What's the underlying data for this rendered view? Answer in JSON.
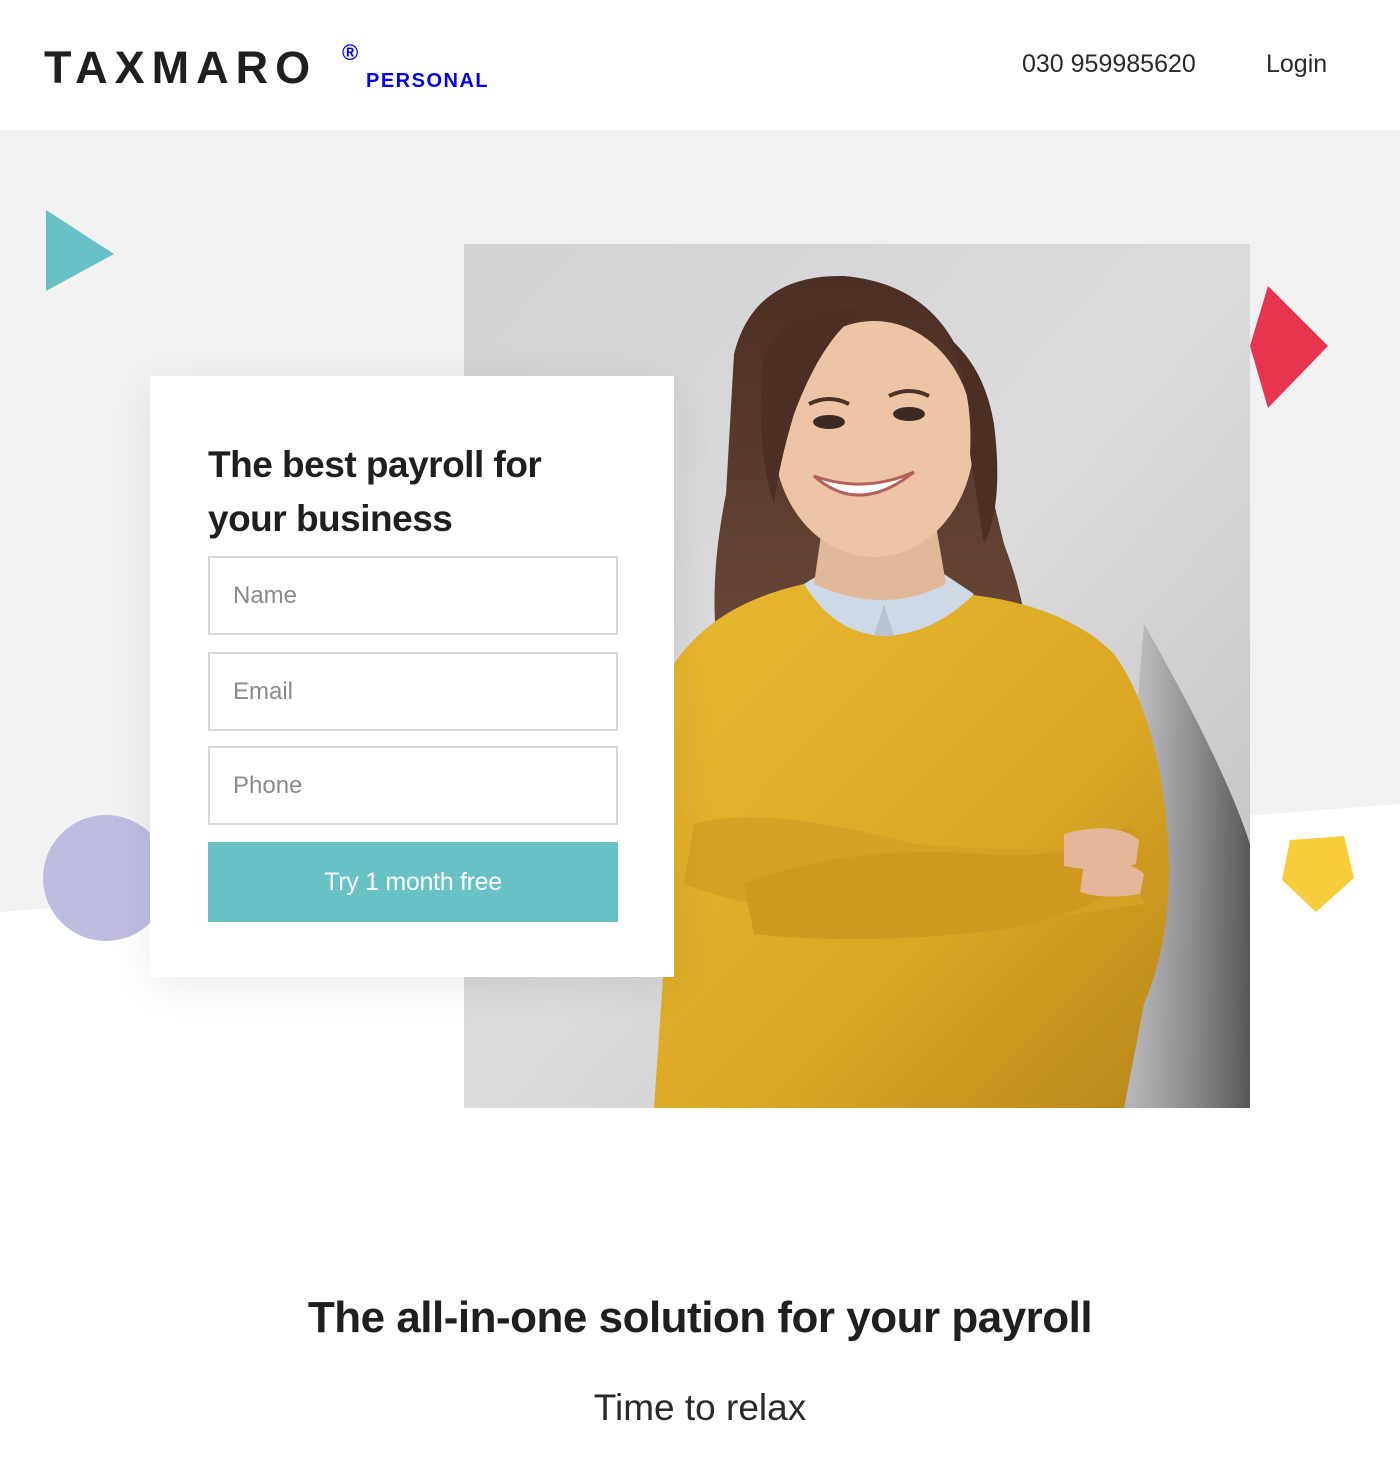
{
  "header": {
    "logo": {
      "brand": "TAXMARO",
      "registered": "®",
      "product": "PERSONAL"
    },
    "phone": "030 959985620",
    "login_label": "Login"
  },
  "hero": {
    "form": {
      "title": "The best payroll for your business",
      "name_placeholder": "Name",
      "email_placeholder": "Email",
      "phone_placeholder": "Phone",
      "submit_label": "Try 1 month free"
    }
  },
  "section": {
    "title": "The all-in-one solution for your payroll",
    "subtitle": "Time to relax"
  },
  "colors": {
    "accent_teal": "#67c1c5",
    "accent_red": "#e8354f",
    "accent_lavender": "#bdbde0",
    "accent_yellow": "#f7cd3b",
    "hero_gray": "#f2f2f2"
  }
}
